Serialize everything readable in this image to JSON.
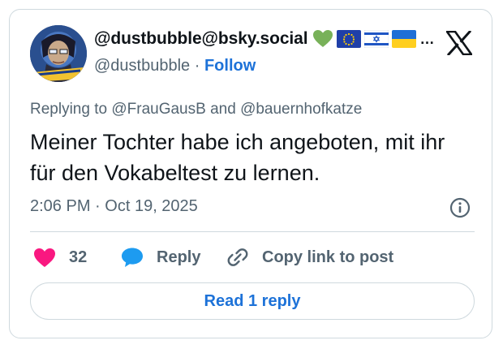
{
  "author": {
    "display_name": "@dustbubble@bsky.social",
    "handle": "@dustbubble",
    "separator": "·",
    "follow_label": "Follow",
    "emojis": [
      "green-heart-icon",
      "eu-flag-icon",
      "israel-flag-icon",
      "ukraine-flag-icon"
    ],
    "overflow": "…"
  },
  "reply_context": {
    "prefix": "Replying to",
    "mention_1": "@FrauGausB",
    "joiner": "and",
    "mention_2": "@bauernhofkatze"
  },
  "tweet": {
    "text": "Meiner Tochter habe ich angeboten, mit ihr für den Vokabeltest zu lernen.",
    "time": "2:06 PM",
    "date_separator": "·",
    "date": "Oct 19, 2025"
  },
  "actions": {
    "like_count": "32",
    "reply_label": "Reply",
    "copy_link_label": "Copy link to post"
  },
  "read_replies_label": "Read 1 reply",
  "colors": {
    "accent": "#1d72d8",
    "like": "#f91880",
    "reply_icon": "#1d9bf0",
    "text_primary": "#0f1419",
    "text_secondary": "#536471",
    "border": "#cfd9de"
  }
}
